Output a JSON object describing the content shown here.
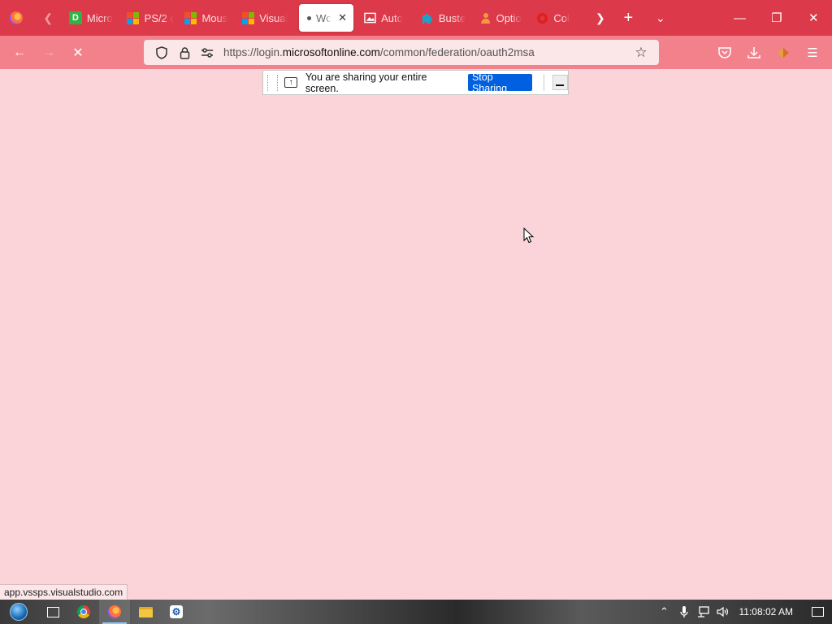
{
  "browser": {
    "tabs": [
      {
        "label": "Micro",
        "icon": "d-icon",
        "icon_color": "#2fb344",
        "glyph": "D"
      },
      {
        "label": "PS/2 c",
        "icon": "windows-logo-icon",
        "icon_color": "#f25022",
        "glyph": ""
      },
      {
        "label": "Mous",
        "icon": "windows-logo-icon",
        "icon_color": "#f25022",
        "glyph": ""
      },
      {
        "label": "Visual",
        "icon": "windows-logo-icon",
        "icon_color": "#f25022",
        "glyph": ""
      },
      {
        "label": "Wc",
        "icon": "loading-dot-icon",
        "active": true
      },
      {
        "label": "Auto",
        "icon": "picture-icon",
        "icon_color": "#ffffff",
        "glyph": ""
      },
      {
        "label": "Buste",
        "icon": "puzzle-icon",
        "icon_color": "#1aa3c8",
        "glyph": ""
      },
      {
        "label": "Optio",
        "icon": "person-icon",
        "icon_color": "#f29b38",
        "glyph": ""
      },
      {
        "label": "Col",
        "icon": "red-circle-icon",
        "icon_color": "#e0201e",
        "glyph": ""
      }
    ],
    "url_prefix": "https://login.",
    "url_domain": "microsoftonline.com",
    "url_path": "/common/federation/oauth2msa",
    "status_text": "app.vssps.visualstudio.com"
  },
  "sharing_bar": {
    "message": "You are sharing your entire screen.",
    "stop_label": "Stop Sharing"
  },
  "taskbar": {
    "clock": "11:08:02 AM"
  },
  "colors": {
    "tabbar": "#dc3a4a",
    "navbar": "#f2818c",
    "page_bg": "#fad4d9",
    "stop_button": "#0060df"
  }
}
